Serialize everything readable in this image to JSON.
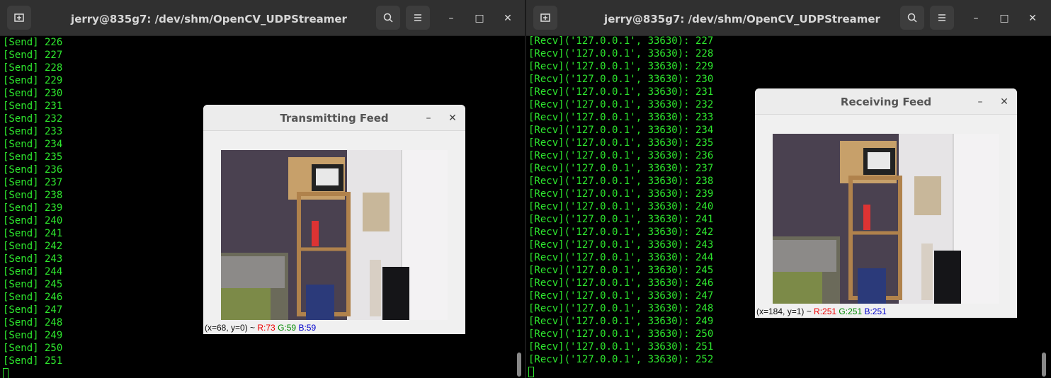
{
  "left_terminal": {
    "title": "jerry@835g7: /dev/shm/OpenCV_UDPStreamer",
    "lines": [
      "[Send] 226",
      "[Send] 227",
      "[Send] 228",
      "[Send] 229",
      "[Send] 230",
      "[Send] 231",
      "[Send] 232",
      "[Send] 233",
      "[Send] 234",
      "[Send] 235",
      "[Send] 236",
      "[Send] 237",
      "[Send] 238",
      "[Send] 239",
      "[Send] 240",
      "[Send] 241",
      "[Send] 242",
      "[Send] 243",
      "[Send] 244",
      "[Send] 245",
      "[Send] 246",
      "[Send] 247",
      "[Send] 248",
      "[Send] 249",
      "[Send] 250",
      "[Send] 251"
    ],
    "icons": {
      "new_tab": "new-tab-icon",
      "search": "search-icon",
      "menu": "hamburger-menu-icon",
      "minimize": "minimize-icon",
      "maximize": "maximize-icon",
      "close": "close-icon"
    }
  },
  "right_terminal": {
    "title": "jerry@835g7: /dev/shm/OpenCV_UDPStreamer",
    "lines": [
      "[Recv]('127.0.0.1', 33630): 227",
      "[Recv]('127.0.0.1', 33630): 228",
      "[Recv]('127.0.0.1', 33630): 229",
      "[Recv]('127.0.0.1', 33630): 230",
      "[Recv]('127.0.0.1', 33630): 231",
      "[Recv]('127.0.0.1', 33630): 232",
      "[Recv]('127.0.0.1', 33630): 233",
      "[Recv]('127.0.0.1', 33630): 234",
      "[Recv]('127.0.0.1', 33630): 235",
      "[Recv]('127.0.0.1', 33630): 236",
      "[Recv]('127.0.0.1', 33630): 237",
      "[Recv]('127.0.0.1', 33630): 238",
      "[Recv]('127.0.0.1', 33630): 239",
      "[Recv]('127.0.0.1', 33630): 240",
      "[Recv]('127.0.0.1', 33630): 241",
      "[Recv]('127.0.0.1', 33630): 242",
      "[Recv]('127.0.0.1', 33630): 243",
      "[Recv]('127.0.0.1', 33630): 244",
      "[Recv]('127.0.0.1', 33630): 245",
      "[Recv]('127.0.0.1', 33630): 246",
      "[Recv]('127.0.0.1', 33630): 247",
      "[Recv]('127.0.0.1', 33630): 248",
      "[Recv]('127.0.0.1', 33630): 249",
      "[Recv]('127.0.0.1', 33630): 250",
      "[Recv]('127.0.0.1', 33630): 251",
      "[Recv]('127.0.0.1', 33630): 252"
    ]
  },
  "transmit_window": {
    "title": "Transmitting Feed",
    "status_coords": "(x=68, y=0) ~ ",
    "status_r": "R:73",
    "status_g": "G:59",
    "status_b": "B:59"
  },
  "receive_window": {
    "title": "Receiving Feed",
    "status_coords": "(x=184, y=1) ~ ",
    "status_r": "R:251",
    "status_g": "G:251",
    "status_b": "B:251"
  },
  "colors": {
    "terminal_text": "#2ee72e",
    "terminal_bg": "#000000",
    "titlebar": "#303030"
  }
}
